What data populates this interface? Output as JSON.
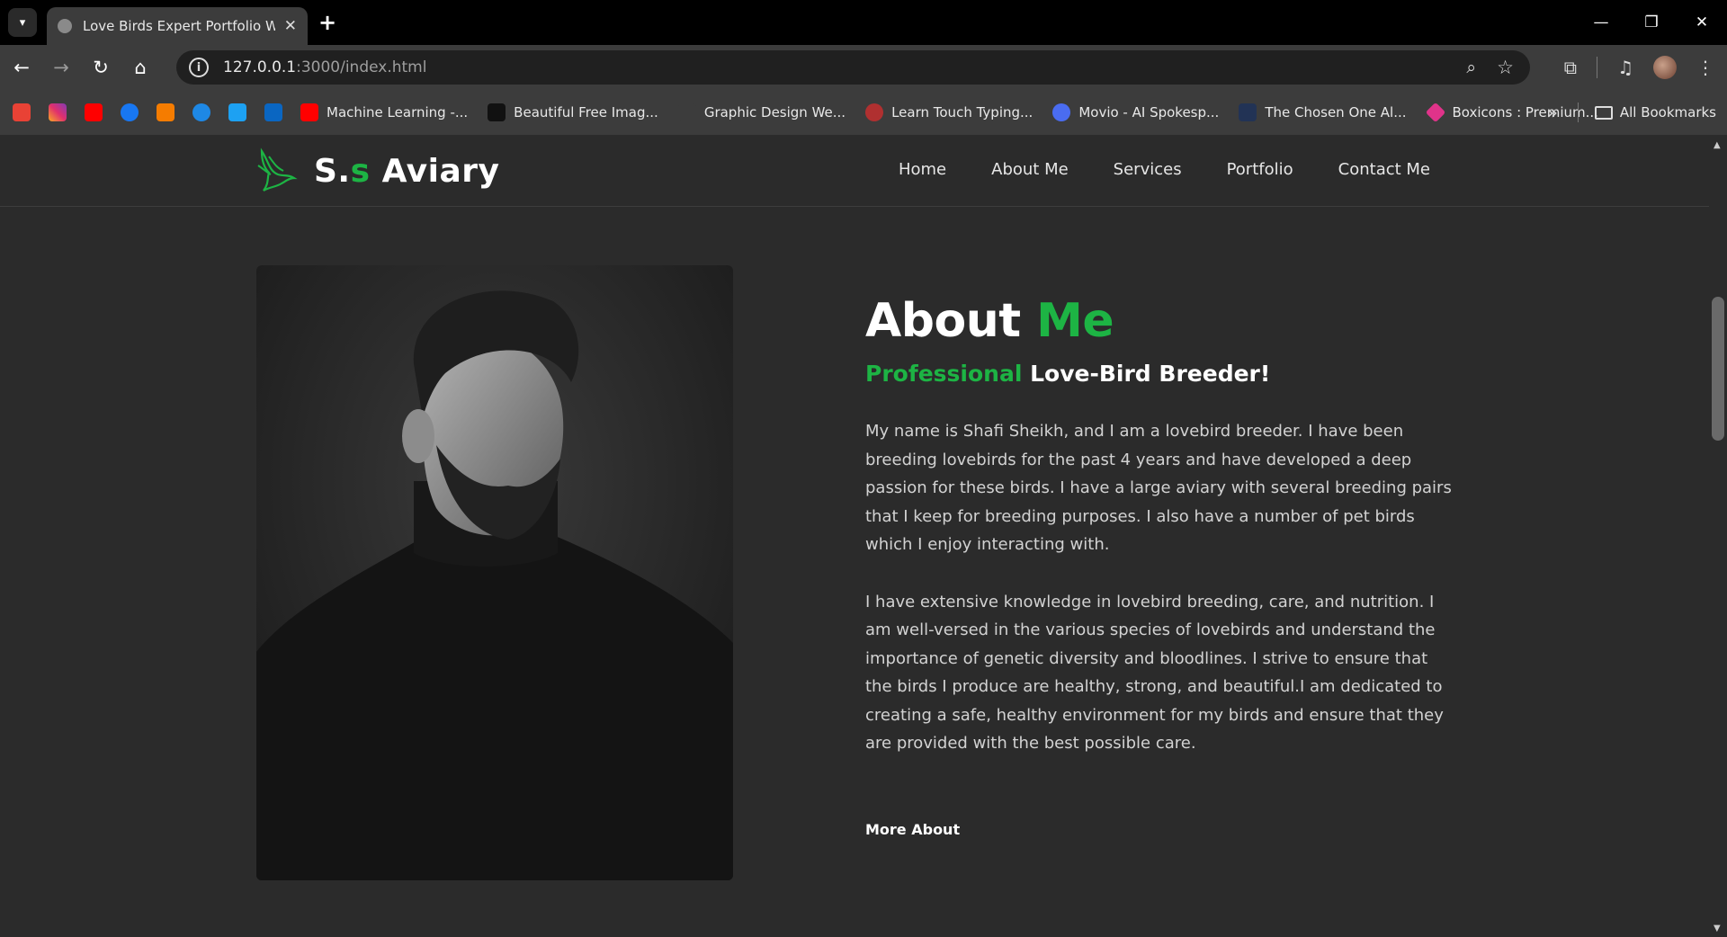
{
  "browser": {
    "tab_title": "Love Birds Expert Portfolio Web",
    "url_host": "127.0.0.1",
    "url_path": ":3000/index.html",
    "bookmarks": [
      {
        "label": "Machine Learning -...",
        "color": "#ff0000"
      },
      {
        "label": "Beautiful Free Imag...",
        "color": "#111111"
      },
      {
        "label": "Graphic Design We...",
        "color": "#3c3c3c"
      },
      {
        "label": "Learn Touch Typing...",
        "color": "#b03030"
      },
      {
        "label": "Movio - AI Spokesp...",
        "color": "#4a6cf0"
      },
      {
        "label": "The Chosen One Al...",
        "color": "#223355"
      },
      {
        "label": "Boxicons : Premium...",
        "color": "#e0338a"
      }
    ],
    "all_bookmarks_label": "All Bookmarks"
  },
  "site": {
    "logo_prefix": "S.",
    "logo_accent": "s",
    "logo_suffix": " Aviary",
    "nav": [
      "Home",
      "About Me",
      "Services",
      "Portfolio",
      "Contact Me"
    ],
    "accent_color": "#1db444"
  },
  "about": {
    "title_main": "About ",
    "title_accent": "Me",
    "subtitle_accent": "Professional",
    "subtitle_rest": " Love-Bird Breeder!",
    "paragraph_1": "My name is Shafi Sheikh, and I am a lovebird breeder. I have been breeding lovebirds for the past 4 years and have developed a deep passion for these birds. I have a large aviary with several breeding pairs that I keep for breeding purposes. I also have a number of pet birds which I enjoy interacting with.",
    "paragraph_2": "I have extensive knowledge in lovebird breeding, care, and nutrition. I am well-versed in the various species of lovebirds and understand the importance of genetic diversity and bloodlines. I strive to ensure that the birds I produce are healthy, strong, and beautiful.I am dedicated to creating a safe, healthy environment for my birds and ensure that they are provided with the best possible care.",
    "more_label": "More About"
  }
}
